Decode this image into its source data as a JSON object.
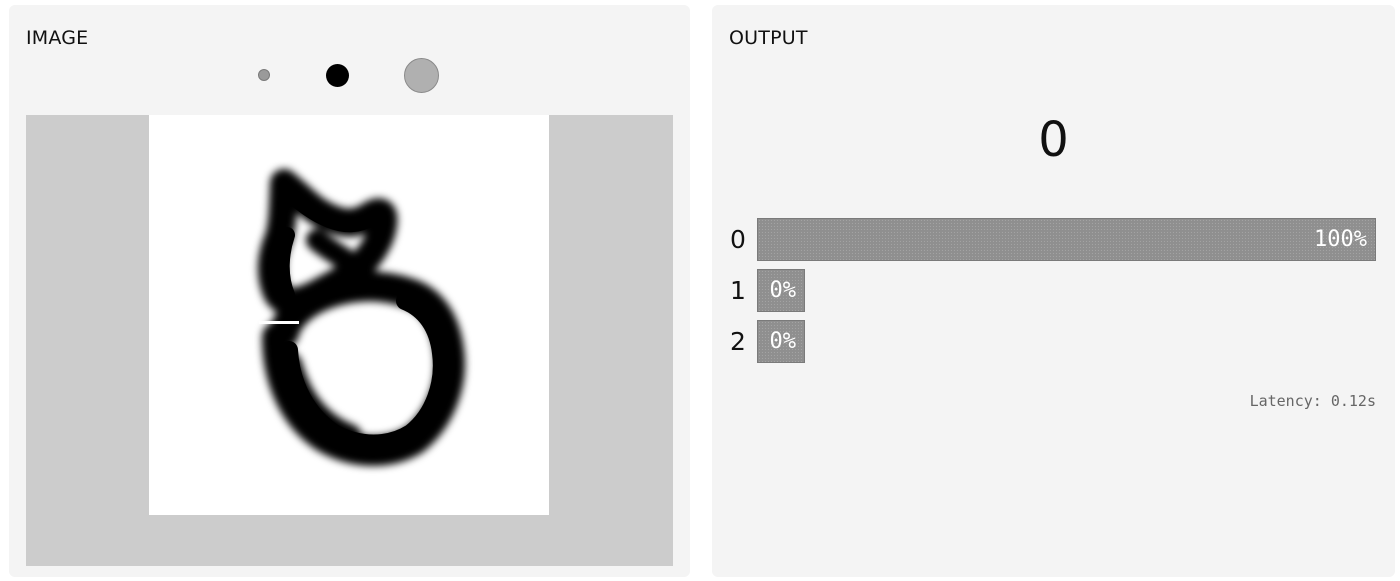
{
  "input": {
    "title": "IMAGE",
    "brush_sizes": [
      "small",
      "medium",
      "large"
    ],
    "selected_brush": "medium"
  },
  "output": {
    "title": "OUTPUT",
    "predicted_label": "0",
    "confidences": [
      {
        "label": "0",
        "value": "100%",
        "fraction": 1.0
      },
      {
        "label": "1",
        "value": "0%",
        "fraction": 0.0
      },
      {
        "label": "2",
        "value": "0%",
        "fraction": 0.0
      }
    ],
    "latency": "Latency: 0.12s"
  },
  "colors": {
    "panel_bg": "#f4f4f4",
    "canvas_frame": "#cccccc",
    "bar": "#8f8f8f"
  }
}
